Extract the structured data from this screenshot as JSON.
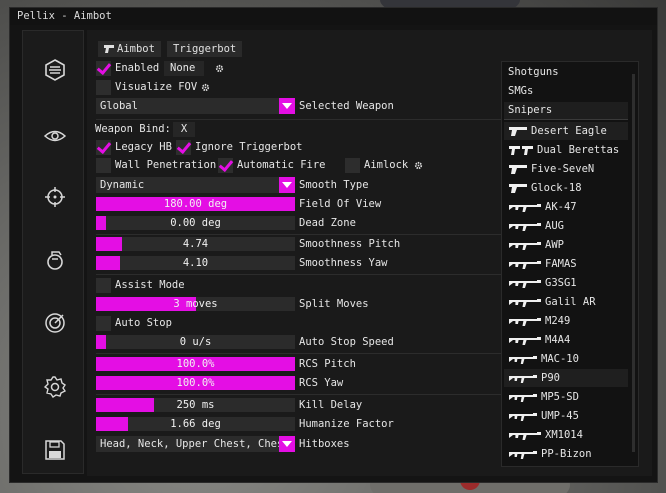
{
  "window": {
    "title": "Pellix - Aimbot"
  },
  "sidebar": {
    "icons": [
      "hexagon-icon",
      "eye-icon",
      "crosshair-icon",
      "grenade-icon",
      "target-icon",
      "gear-icon",
      "save-icon"
    ]
  },
  "tabs": {
    "aimbot": "Aimbot",
    "triggerbot": "Triggerbot",
    "active": "Aimbot"
  },
  "controls": {
    "enabled": {
      "label": "Enabled",
      "checked": true,
      "key": "None"
    },
    "visualize_fov": {
      "label": "Visualize FOV",
      "checked": false
    },
    "weapon_combo": {
      "value": "Global",
      "label": "Selected Weapon"
    },
    "weapon_bind": {
      "label": "Weapon Bind:",
      "key": "X"
    },
    "legacy_hb": {
      "label": "Legacy HB",
      "checked": true
    },
    "ignore_triggerbot": {
      "label": "Ignore Triggerbot",
      "checked": true
    },
    "wall_penetration": {
      "label": "Wall Penetration",
      "checked": false
    },
    "automatic_fire": {
      "label": "Automatic Fire",
      "checked": true
    },
    "aimlock": {
      "label": "Aimlock",
      "checked": false
    },
    "smooth_type": {
      "value": "Dynamic",
      "label": "Smooth Type"
    },
    "fov": {
      "value": "180.00 deg",
      "label": "Field Of View",
      "fraction": 1.0
    },
    "dead_zone": {
      "value": "0.00 deg",
      "label": "Dead Zone",
      "fraction": 0.0
    },
    "smooth_pitch": {
      "value": "4.74",
      "label": "Smoothness Pitch",
      "fraction": 0.13
    },
    "smooth_yaw": {
      "value": "4.10",
      "label": "Smoothness Yaw",
      "fraction": 0.12
    },
    "assist_mode": {
      "label": "Assist Mode",
      "checked": false
    },
    "split_moves": {
      "value": "3 moves",
      "label": "Split Moves",
      "fraction": 0.5
    },
    "auto_stop": {
      "label": "Auto Stop",
      "checked": false
    },
    "auto_stop_speed": {
      "value": "0 u/s",
      "label": "Auto Stop Speed",
      "fraction": 0.0
    },
    "rcs_pitch": {
      "value": "100.0%",
      "label": "RCS Pitch",
      "fraction": 1.0
    },
    "rcs_yaw": {
      "value": "100.0%",
      "label": "RCS Yaw",
      "fraction": 1.0
    },
    "kill_delay": {
      "value": "250 ms",
      "label": "Kill Delay",
      "fraction": 0.29
    },
    "humanize": {
      "value": "1.66 deg",
      "label": "Humanize Factor",
      "fraction": 0.16
    },
    "hitboxes": {
      "value": "Head, Neck, Upper Chest, Chest",
      "label": "Hitboxes"
    }
  },
  "weapon_list": {
    "categories": [
      "Shotguns",
      "SMGs",
      "Snipers"
    ],
    "selected_category": "Snipers",
    "weapons": [
      "Desert Eagle",
      "Dual Berettas",
      "Five-SeveN",
      "Glock-18",
      "AK-47",
      "AUG",
      "AWP",
      "FAMAS",
      "G3SG1",
      "Galil AR",
      "M249",
      "M4A4",
      "MAC-10",
      "P90",
      "MP5-SD",
      "UMP-45",
      "XM1014",
      "PP-Bizon"
    ],
    "highlighted": [
      "Desert Eagle",
      "P90"
    ]
  },
  "colors": {
    "accent": "#e40ee4",
    "panel": "#1a1a1a",
    "control": "#2b2b2b"
  }
}
